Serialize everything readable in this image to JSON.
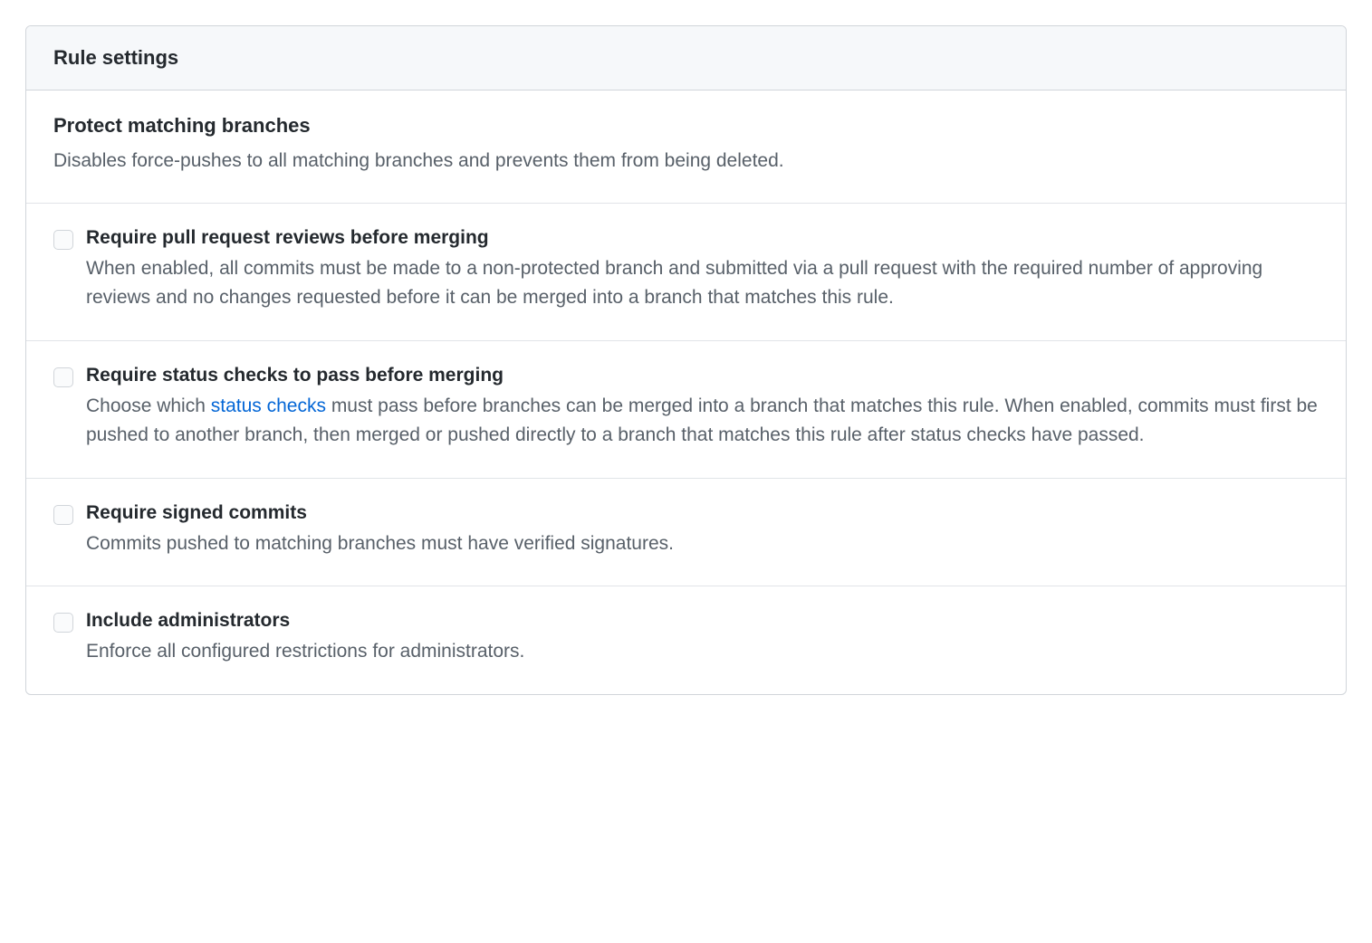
{
  "header": {
    "title": "Rule settings"
  },
  "intro": {
    "title": "Protect matching branches",
    "description": "Disables force-pushes to all matching branches and prevents them from being deleted."
  },
  "rules": [
    {
      "id": "require-pr-reviews",
      "title": "Require pull request reviews before merging",
      "description_before": "When enabled, all commits must be made to a non-protected branch and submitted via a pull request with the required number of approving reviews and no changes requested before it can be merged into a branch that matches this rule.",
      "link_text": "",
      "description_after": ""
    },
    {
      "id": "require-status-checks",
      "title": "Require status checks to pass before merging",
      "description_before": "Choose which ",
      "link_text": "status checks",
      "description_after": " must pass before branches can be merged into a branch that matches this rule. When enabled, commits must first be pushed to another branch, then merged or pushed directly to a branch that matches this rule after status checks have passed."
    },
    {
      "id": "require-signed-commits",
      "title": "Require signed commits",
      "description_before": "Commits pushed to matching branches must have verified signatures.",
      "link_text": "",
      "description_after": ""
    },
    {
      "id": "include-administrators",
      "title": "Include administrators",
      "description_before": "Enforce all configured restrictions for administrators.",
      "link_text": "",
      "description_after": ""
    }
  ]
}
